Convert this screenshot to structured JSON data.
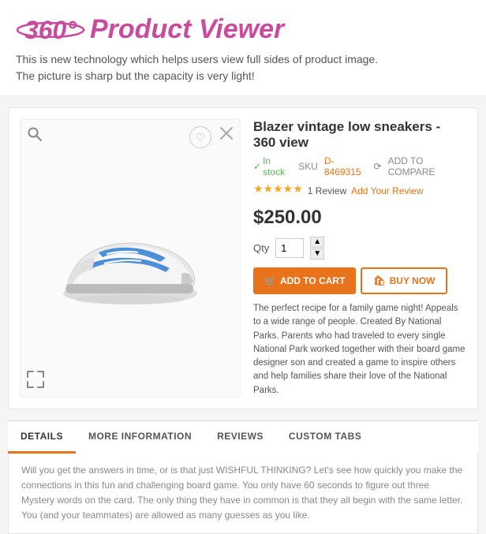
{
  "header": {
    "title_360": "360°",
    "title_product": "Product Viewer",
    "subtitle_line1": "This is new technology which helps users view full sides of product image.",
    "subtitle_line2": "The picture is sharp but the capacity is very light!"
  },
  "product": {
    "title": "Blazer vintage low sneakers - 360 view",
    "in_stock": "In stock",
    "sku_label": "SKU",
    "sku_value": "D-8469315",
    "compare_label": "ADD TO COMPARE",
    "stars": "★★★★★",
    "review_count": "1 Review",
    "add_review": "Add Your Review",
    "price": "$250.00",
    "qty_label": "Qty",
    "qty_value": "1",
    "btn_cart": "ADD TO CART",
    "btn_buy": "BUY NOW",
    "description": "The perfect recipe for a family game night! Appeals to a wide range of people. Created By National Parks. Parents who had traveled to every single National Park worked together with their board game designer son and created a game to inspire others and help families share their love of the National Parks."
  },
  "tabs": [
    {
      "id": "details",
      "label": "DETAILS",
      "active": true
    },
    {
      "id": "more-info",
      "label": "MORE INFORMATION",
      "active": false
    },
    {
      "id": "reviews",
      "label": "REVIEWS",
      "active": false
    },
    {
      "id": "custom-tabs",
      "label": "CUSTOM TABS",
      "active": false
    }
  ],
  "tab_content": "Will you get the answers in time, or is that just WISHFUL THINKING? Let's see how quickly you make the connections in this fun and challenging board game. You only have 60 seconds to figure out three Mystery words on the card. The only thing they have in common is that they all begin with the same letter. You (and your teammates) are allowed as many guesses as you like.",
  "icons": {
    "search": "🔍",
    "expand": "⤢",
    "close": "✕",
    "heart": "♡",
    "cart": "🛒",
    "bag": "🛍",
    "compare": "⟳",
    "check": "✓",
    "up": "▲",
    "down": "▼"
  },
  "colors": {
    "accent": "#e8731a",
    "brand": "#c94b9e",
    "green": "#5cb85c",
    "star": "#f5a623"
  }
}
